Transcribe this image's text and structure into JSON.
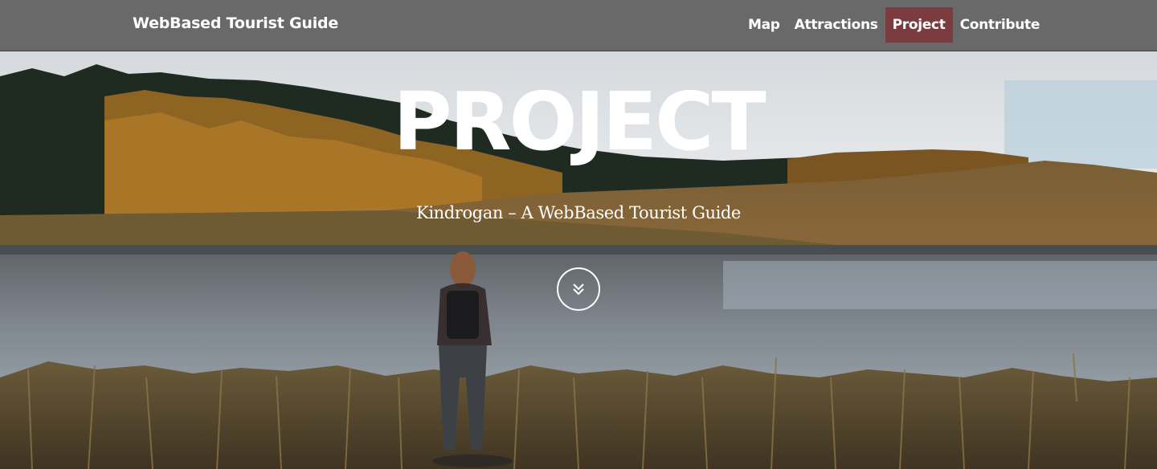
{
  "navbar": {
    "brand": "WebBased Tourist Guide",
    "items": [
      {
        "label": "Map",
        "active": false
      },
      {
        "label": "Attractions",
        "active": false
      },
      {
        "label": "Project",
        "active": true
      },
      {
        "label": "Contribute",
        "active": false
      }
    ],
    "active_color": "#7a3c3e"
  },
  "hero": {
    "title": "PROJECT",
    "subtitle": "Kindrogan – A WebBased Tourist Guide",
    "scroll_icon": "double-chevron-down-icon"
  }
}
